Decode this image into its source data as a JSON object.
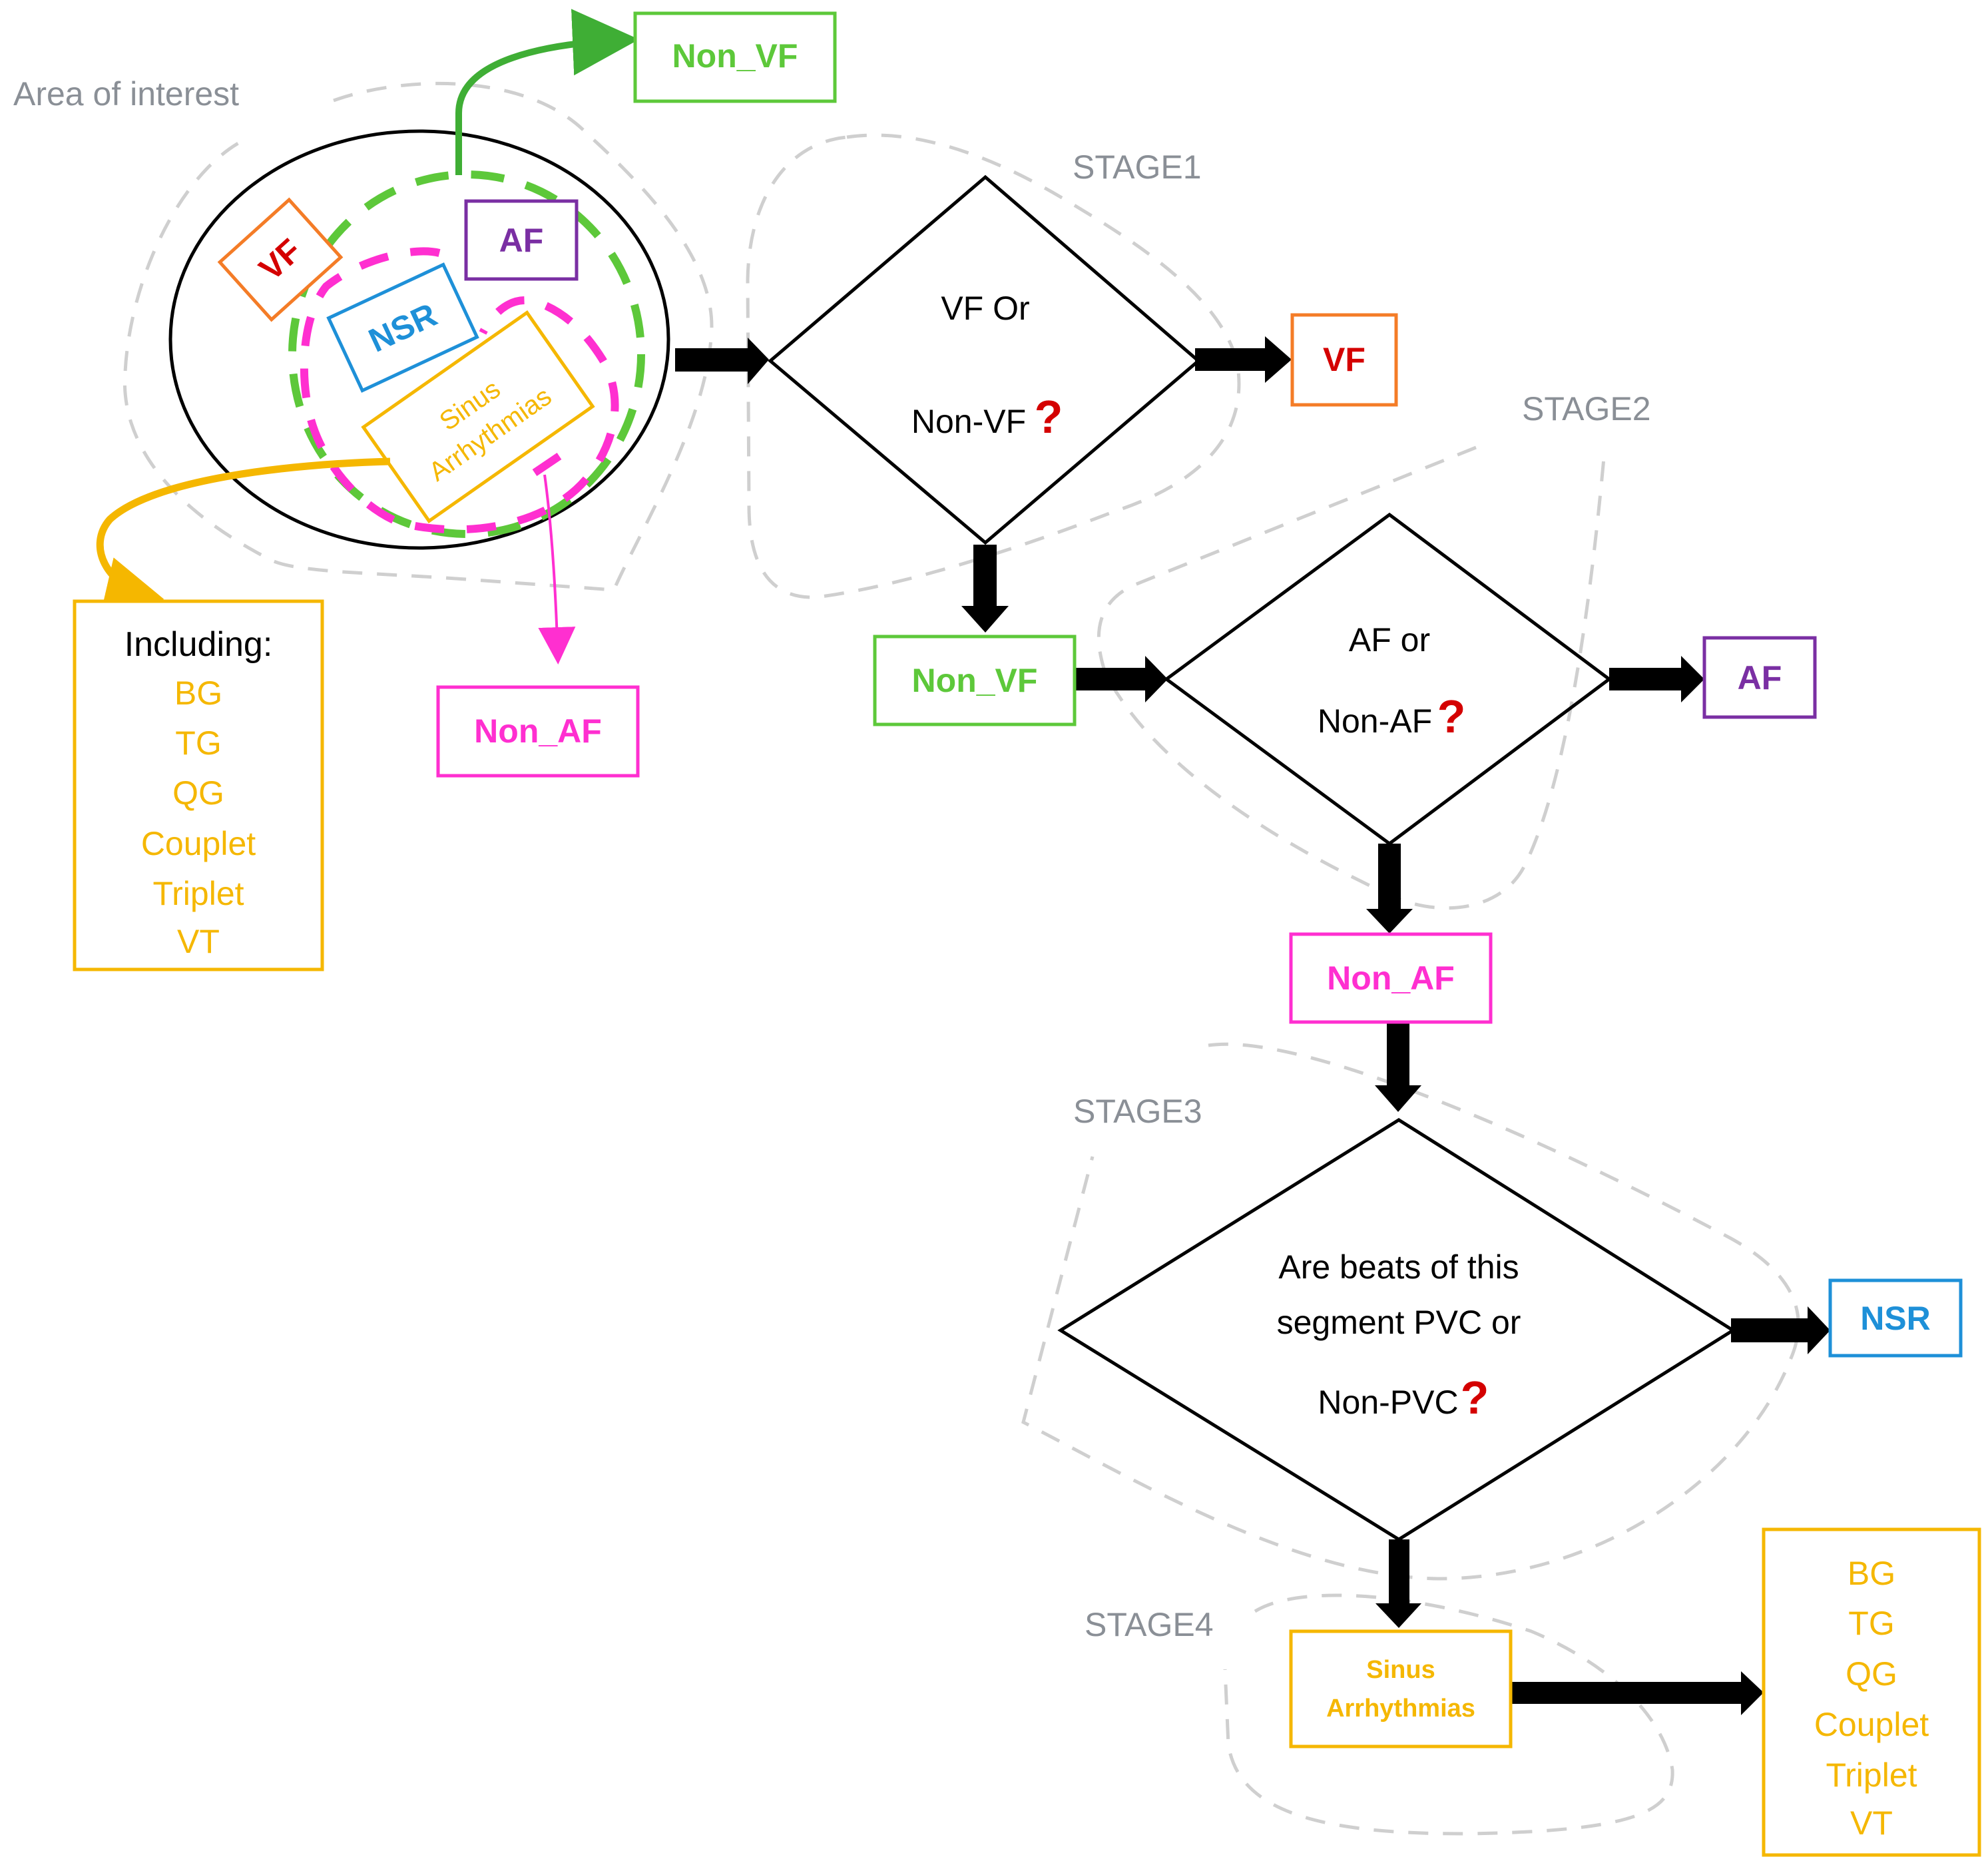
{
  "colors": {
    "vf_border": "#f47c27",
    "vf_text": "#d40000",
    "non_vf": "#5dc83a",
    "non_vf_arrow": "#3fae35",
    "af": "#7a2fa3",
    "non_af": "#ff2fd0",
    "nsr": "#1e90d8",
    "sinus": "#f5b700",
    "stage_label": "#8a8f96",
    "question_mark": "#d40000",
    "outline_gray": "#cfcfcf"
  },
  "area_of_interest": {
    "label": "Area of interest",
    "inner_labels": {
      "vf": "VF",
      "af": "AF",
      "nsr": "NSR",
      "sinus_line1": "Sinus",
      "sinus_line2": "Arrhythmias"
    },
    "non_vf_output": "Non_VF",
    "non_af_output": "Non_AF",
    "including": {
      "title": "Including:",
      "items": [
        "BG",
        "TG",
        "QG",
        "Couplet",
        "Triplet",
        "VT"
      ]
    }
  },
  "stages": [
    {
      "label": "STAGE1",
      "question_line1": "VF Or",
      "question_line2": "Non-VF",
      "question_mark": "?",
      "positive_output": "VF",
      "negative_output": "Non_VF"
    },
    {
      "label": "STAGE2",
      "question_line1": "AF or",
      "question_line2": "Non-AF",
      "question_mark": "?",
      "positive_output": "AF",
      "negative_output": "Non_AF"
    },
    {
      "label": "STAGE3",
      "question_line1": "Are beats of this",
      "question_line2": "segment PVC or",
      "question_line3": "Non-PVC",
      "question_mark": "?",
      "positive_output": "NSR",
      "negative_output_line1": "Sinus",
      "negative_output_line2": "Arrhythmias"
    },
    {
      "label": "STAGE4",
      "result_items": [
        "BG",
        "TG",
        "QG",
        "Couplet",
        "Triplet",
        "VT"
      ]
    }
  ]
}
